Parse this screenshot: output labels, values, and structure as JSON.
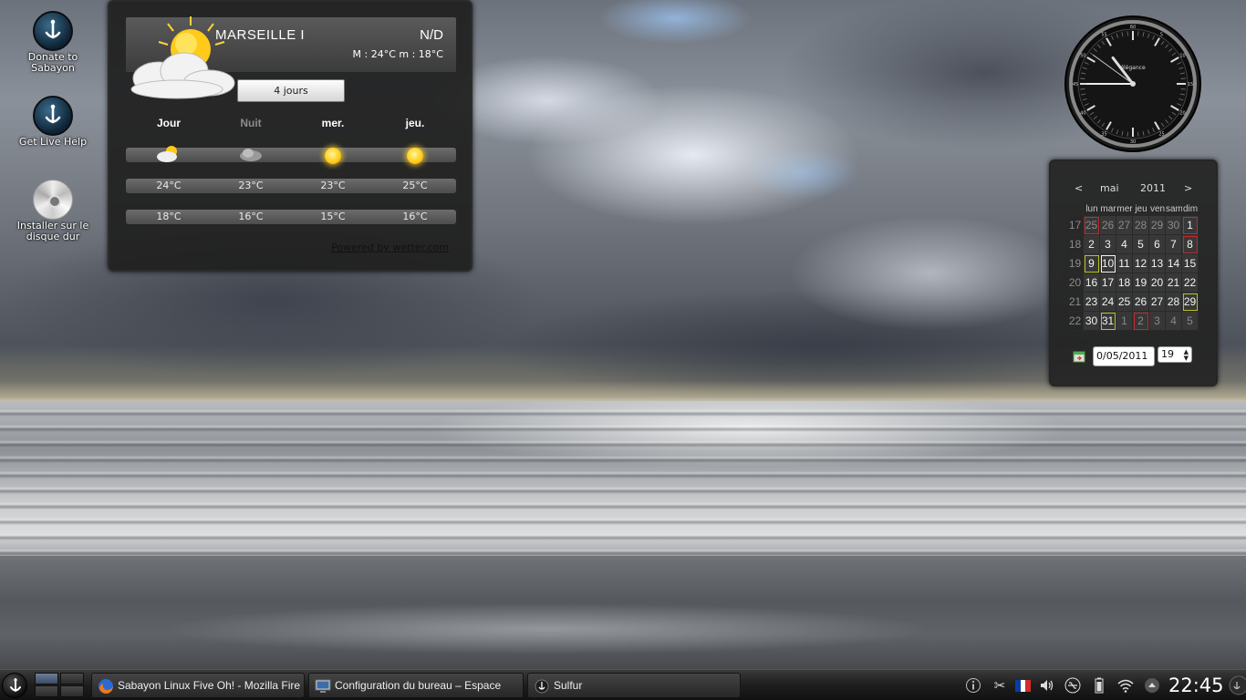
{
  "desktop_icons": [
    {
      "label_line1": "Donate to",
      "label_line2": "Sabayon",
      "icon": "sabayon-logo-icon"
    },
    {
      "label_line1": "Get Live Help",
      "label_line2": "",
      "icon": "sabayon-logo-icon"
    },
    {
      "label_line1": "Installer sur le",
      "label_line2": "disque dur",
      "icon": "cd-disc-icon"
    }
  ],
  "weather": {
    "city": "MARSEILLE I",
    "condition_code": "N/D",
    "minmax": "M : 24°C m : 18°C",
    "days_button": "4 jours",
    "columns": [
      "Jour",
      "Nuit",
      "mer.",
      "jeu."
    ],
    "high_temps": [
      "24°C",
      "23°C",
      "23°C",
      "25°C"
    ],
    "low_temps": [
      "18°C",
      "16°C",
      "15°C",
      "16°C"
    ],
    "powered_by": "Powered by wetter.com",
    "icons": [
      "partly-cloudy-sun-icon",
      "cloudy-night-icon",
      "sun-icon",
      "sun-icon"
    ]
  },
  "clock": {
    "brand": "élégance",
    "hour": 22,
    "minute": 45,
    "second": 51,
    "marks": [
      "5",
      "10",
      "15",
      "20",
      "25",
      "30",
      "35",
      "40",
      "45",
      "50",
      "55",
      "60"
    ]
  },
  "calendar": {
    "prev": "<",
    "month": "mai",
    "year": "2011",
    "next": ">",
    "weekday_headers": [
      "lun",
      "mar",
      "mer",
      "jeu",
      "ven",
      "sam",
      "dim"
    ],
    "weeks": [
      {
        "week": "17",
        "days": [
          "25",
          "26",
          "27",
          "28",
          "29",
          "30",
          "1"
        ]
      },
      {
        "week": "18",
        "days": [
          "2",
          "3",
          "4",
          "5",
          "6",
          "7",
          "8"
        ]
      },
      {
        "week": "19",
        "days": [
          "9",
          "10",
          "11",
          "12",
          "13",
          "14",
          "15"
        ]
      },
      {
        "week": "20",
        "days": [
          "16",
          "17",
          "18",
          "19",
          "20",
          "21",
          "22"
        ]
      },
      {
        "week": "21",
        "days": [
          "23",
          "24",
          "25",
          "26",
          "27",
          "28",
          "29"
        ]
      },
      {
        "week": "22",
        "days": [
          "30",
          "31",
          "1",
          "2",
          "3",
          "4",
          "5"
        ]
      }
    ],
    "date_input": "0/05/2011",
    "week_spin": "19"
  },
  "taskbar": {
    "tasks": [
      {
        "label": "Sabayon Linux Five Oh! - Mozilla Fire",
        "icon": "firefox-icon"
      },
      {
        "label": "Configuration du bureau – Espace",
        "icon": "desktop-settings-icon"
      },
      {
        "label": "Sulfur",
        "icon": "sulfur-icon"
      }
    ],
    "time": "22:45"
  },
  "colors": {
    "holiday_outline": "#c12a2a",
    "event_outline": "#b9c21c",
    "today_outline": "#f2f2f2"
  }
}
